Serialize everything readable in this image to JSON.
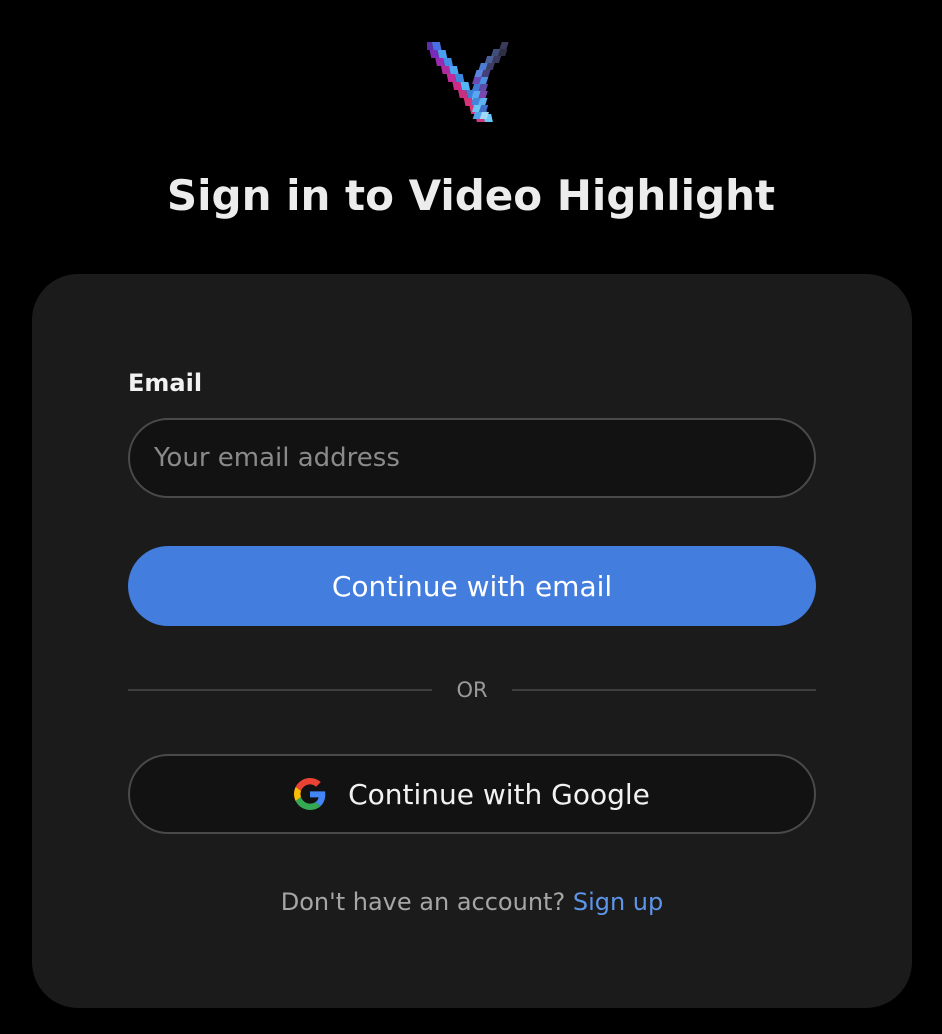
{
  "header": {
    "logo_icon": "video-highlight-logo-icon",
    "title": "Sign in to Video Highlight"
  },
  "form": {
    "email_label": "Email",
    "email_value": "",
    "email_placeholder": "Your email address",
    "continue_email_label": "Continue with email",
    "divider_text": "OR",
    "google_icon": "google-icon",
    "continue_google_label": "Continue with Google"
  },
  "footer": {
    "prompt_text": "Don't have an account?",
    "signup_label": "Sign up"
  },
  "colors": {
    "background": "#000000",
    "card": "#1b1b1b",
    "primary_button": "#437ddd",
    "link": "#5e95e8",
    "border": "#4a4a4a"
  }
}
